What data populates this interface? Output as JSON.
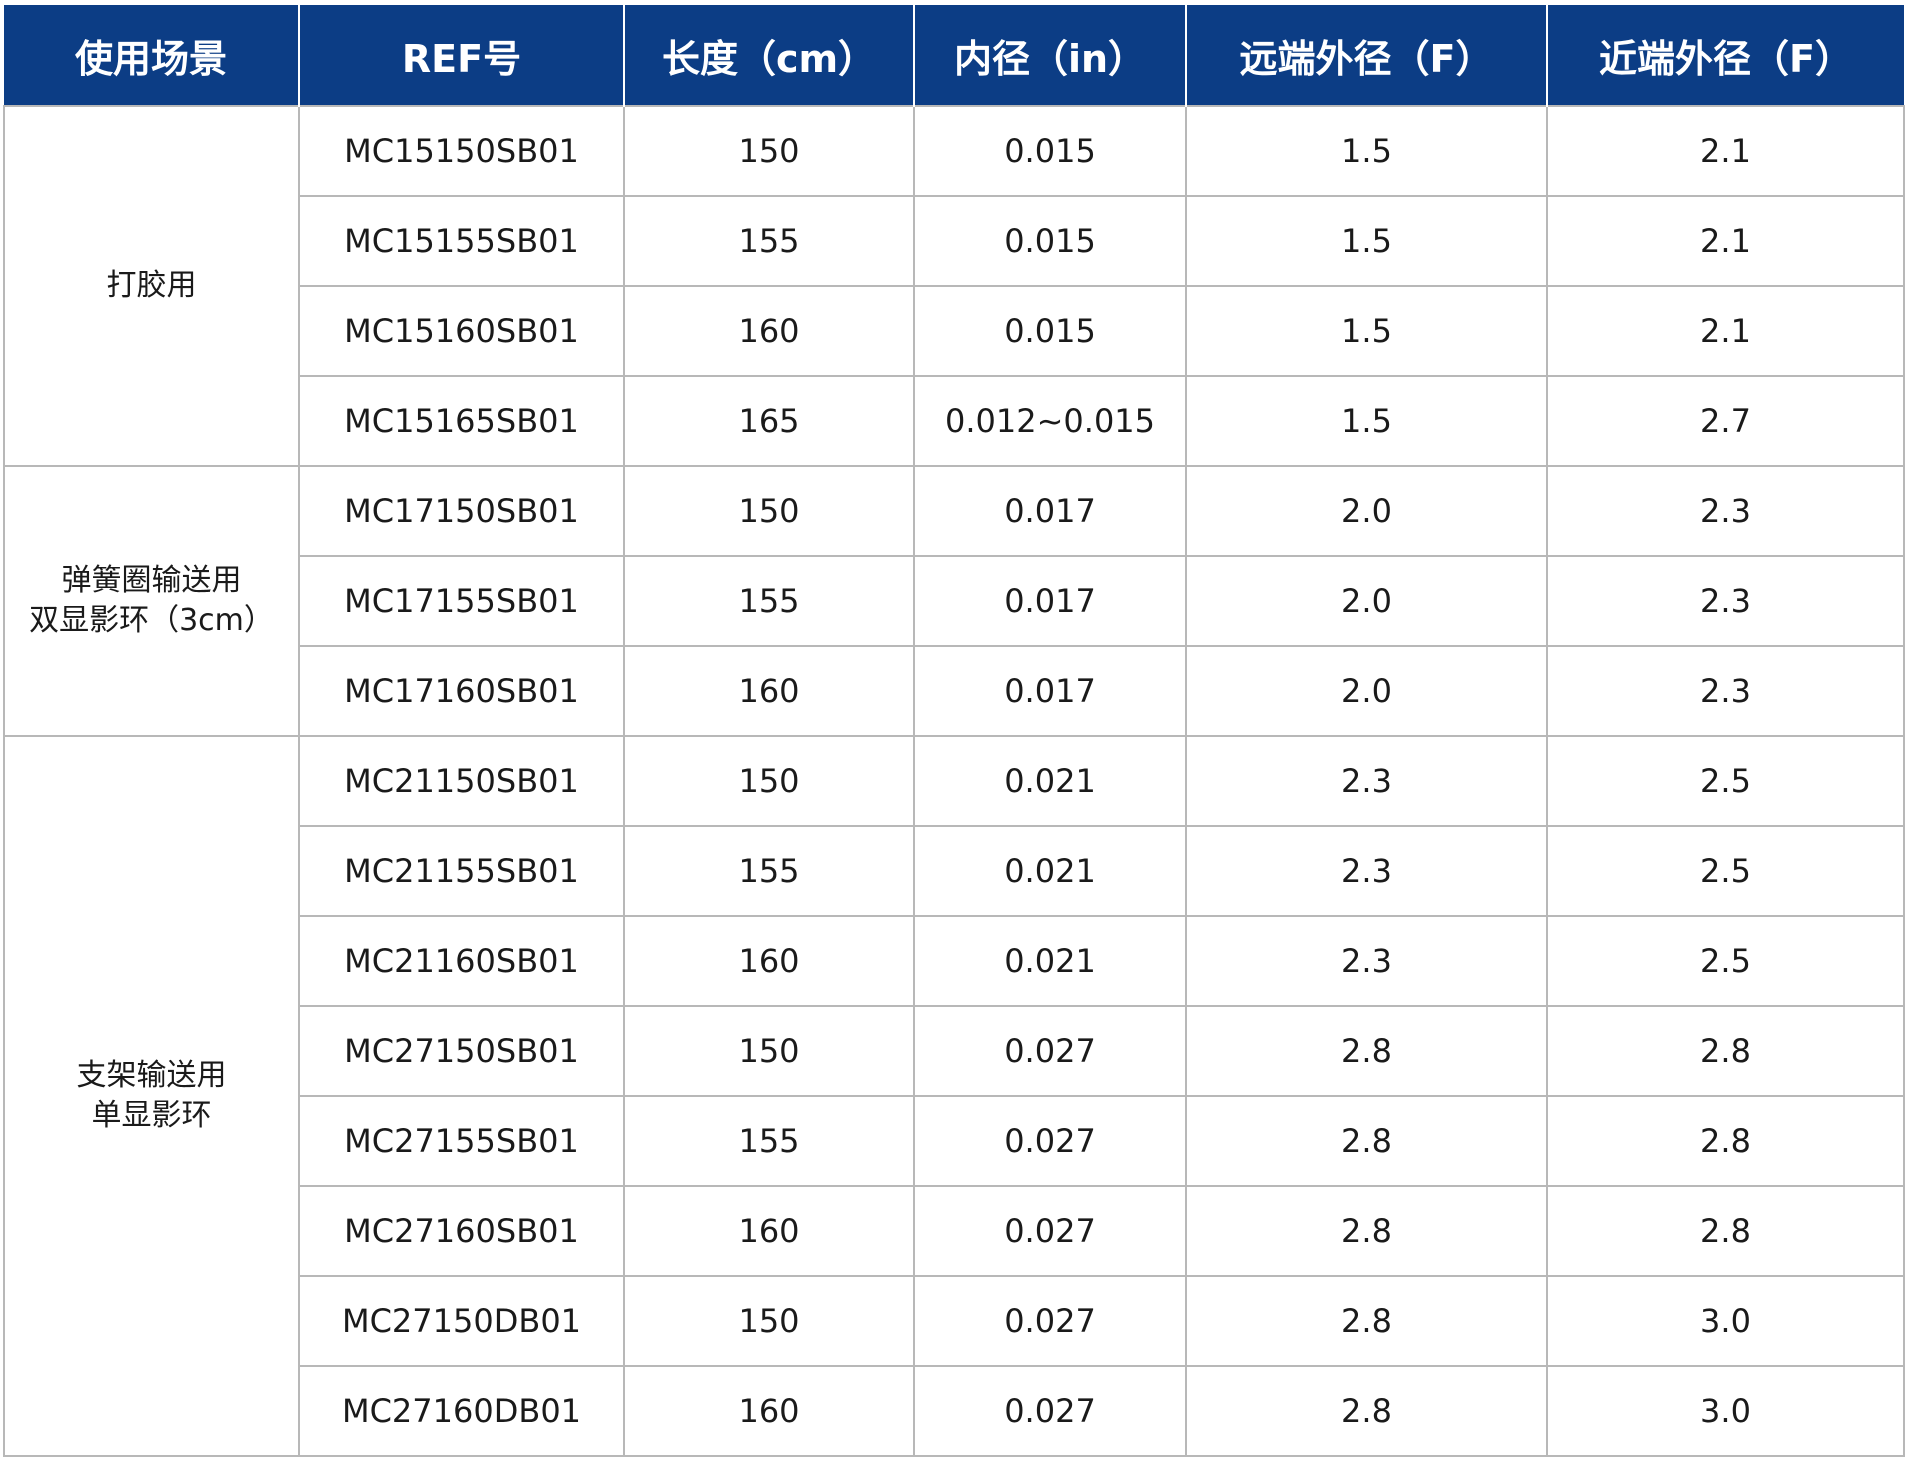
{
  "table": {
    "headers": [
      "使用场景",
      "REF号",
      "长度（cm）",
      "内径（in）",
      "远端外径（F）",
      "近端外径（F）"
    ],
    "groups": [
      {
        "scene": [
          "打胶用"
        ],
        "rows": [
          [
            "MC15150SB01",
            "150",
            "0.015",
            "1.5",
            "2.1"
          ],
          [
            "MC15155SB01",
            "155",
            "0.015",
            "1.5",
            "2.1"
          ],
          [
            "MC15160SB01",
            "160",
            "0.015",
            "1.5",
            "2.1"
          ],
          [
            "MC15165SB01",
            "165",
            "0.012~0.015",
            "1.5",
            "2.7"
          ]
        ]
      },
      {
        "scene": [
          "弹簧圈输送用",
          "双显影环（3cm）"
        ],
        "rows": [
          [
            "MC17150SB01",
            "150",
            "0.017",
            "2.0",
            "2.3"
          ],
          [
            "MC17155SB01",
            "155",
            "0.017",
            "2.0",
            "2.3"
          ],
          [
            "MC17160SB01",
            "160",
            "0.017",
            "2.0",
            "2.3"
          ]
        ]
      },
      {
        "scene": [
          "支架输送用",
          "单显影环"
        ],
        "rows": [
          [
            "MC21150SB01",
            "150",
            "0.021",
            "2.3",
            "2.5"
          ],
          [
            "MC21155SB01",
            "155",
            "0.021",
            "2.3",
            "2.5"
          ],
          [
            "MC21160SB01",
            "160",
            "0.021",
            "2.3",
            "2.5"
          ],
          [
            "MC27150SB01",
            "150",
            "0.027",
            "2.8",
            "2.8"
          ],
          [
            "MC27155SB01",
            "155",
            "0.027",
            "2.8",
            "2.8"
          ],
          [
            "MC27160SB01",
            "160",
            "0.027",
            "2.8",
            "2.8"
          ],
          [
            "MC27150DB01",
            "150",
            "0.027",
            "2.8",
            "3.0"
          ],
          [
            "MC27160DB01",
            "160",
            "0.027",
            "2.8",
            "3.0"
          ]
        ]
      }
    ]
  },
  "colors": {
    "header_bg": "#0c3d85",
    "header_text": "#ffffff",
    "grid": "#b8b8b8",
    "cell_text": "#1a1a1a"
  }
}
